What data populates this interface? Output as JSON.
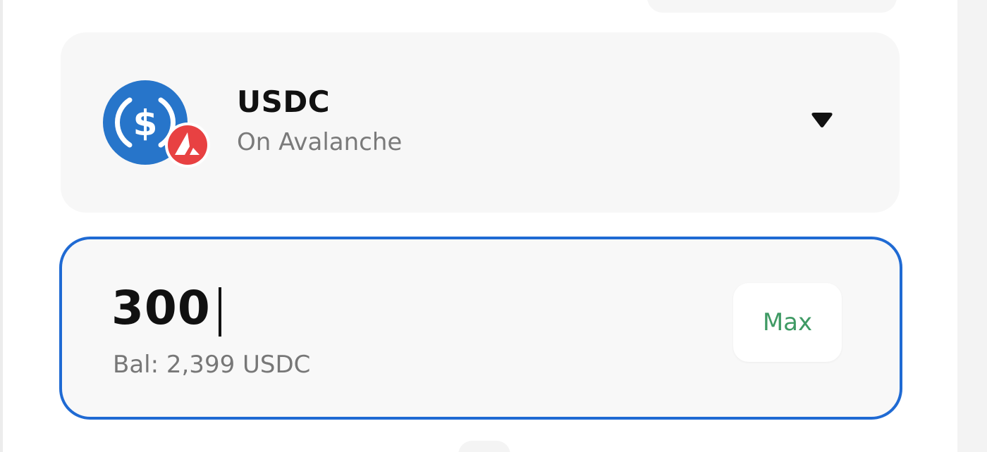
{
  "token": {
    "symbol": "USDC",
    "network": "On Avalanche",
    "icon": "usdc-coin-icon",
    "network_badge_icon": "avalanche-badge-icon",
    "dropdown_icon": "dropdown-caret-icon"
  },
  "amount": {
    "value": "300",
    "balance_text": "Bal: 2,399 USDC",
    "max_label": "Max"
  },
  "colors": {
    "usdc_blue": "#2775ca",
    "avalanche_red": "#e84142",
    "focus_border": "#1f6ad3",
    "max_green": "#3f9a64"
  }
}
